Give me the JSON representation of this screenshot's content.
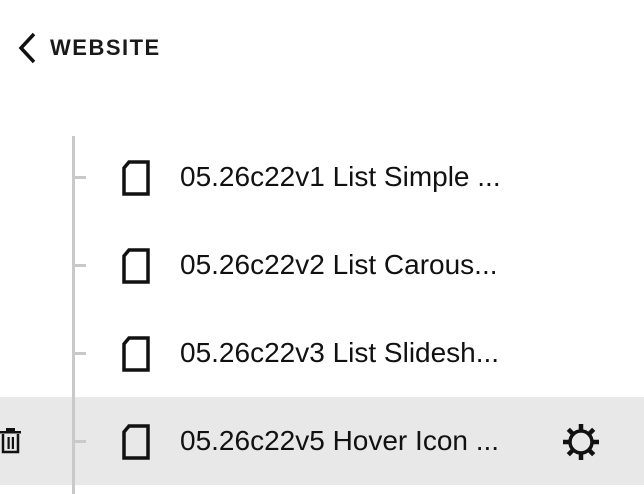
{
  "header": {
    "back_label": "WEBSITE",
    "back_icon": "chevron-left-icon"
  },
  "pages": [
    {
      "title": "05.26c22v1 List Simple ...",
      "icon": "page-icon",
      "active": false
    },
    {
      "title": "05.26c22v2 List Carous...",
      "icon": "page-icon",
      "active": false
    },
    {
      "title": "05.26c22v3 List Slidesh...",
      "icon": "page-icon",
      "active": false
    },
    {
      "title": "05.26c22v5 Hover Icon ...",
      "icon": "page-icon",
      "active": true,
      "row_actions": [
        "trash-icon",
        "gear-icon"
      ]
    }
  ],
  "colors": {
    "active_row_bg": "#e8e8e8",
    "tree_line": "#c9c9c9",
    "text": "#111111"
  }
}
